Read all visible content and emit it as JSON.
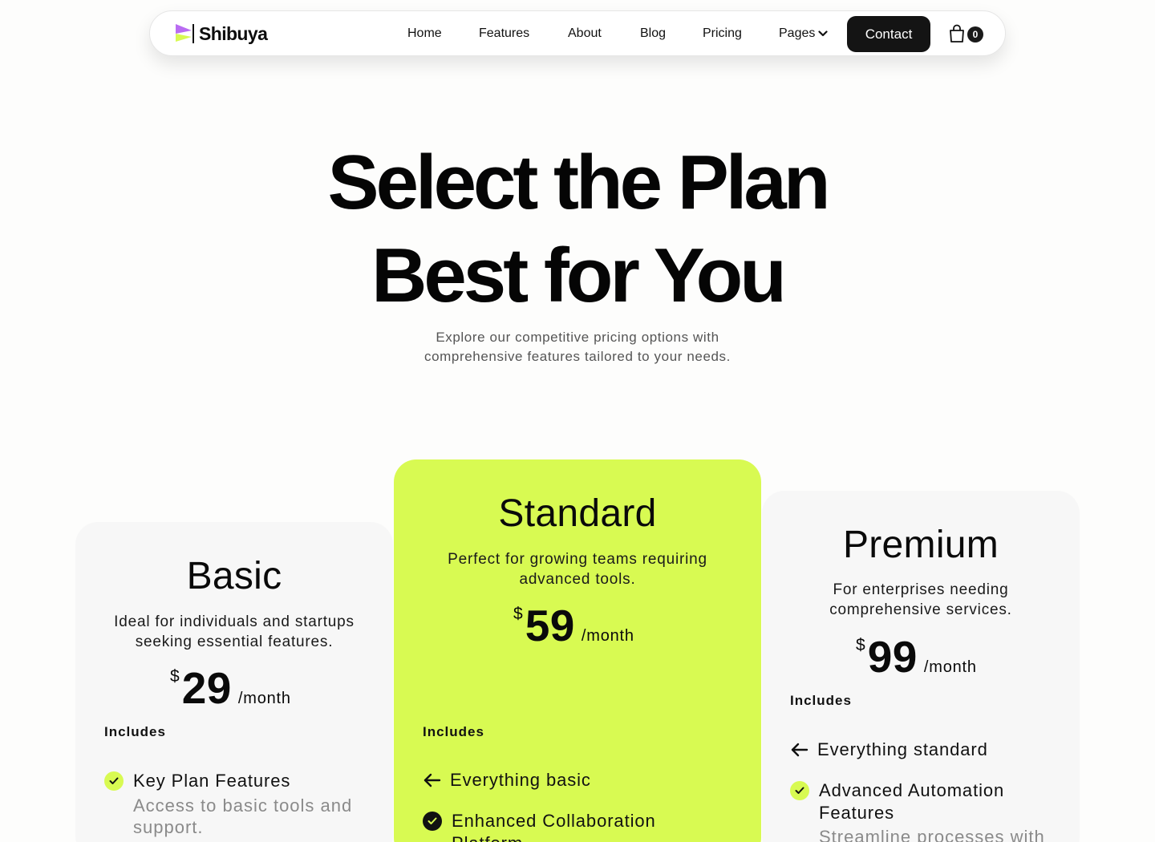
{
  "brand": {
    "name": "Shibuya",
    "logo_icon": "flag-logo-icon",
    "accent": "#d8fa52",
    "logo_purple": "#b96cf2"
  },
  "nav": {
    "links": [
      "Home",
      "Features",
      "About",
      "Blog",
      "Pricing"
    ],
    "pages_label": "Pages",
    "contact_label": "Contact",
    "cart_count": "0"
  },
  "hero": {
    "title_line1": "Select the Plan",
    "title_line2": "Best for You",
    "subtitle_line1": "Explore our competitive pricing options with",
    "subtitle_line2": "comprehensive features tailored to your needs."
  },
  "plans": [
    {
      "name": "Basic",
      "desc_line1": "Ideal for individuals and startups",
      "desc_line2": "seeking essential features.",
      "currency": "$",
      "price": "29",
      "period": "/month",
      "includes_label": "Includes",
      "features": [
        {
          "icon": "check-circle-icon",
          "title": "Key Plan Features",
          "desc_line1": "Access to basic tools and",
          "desc_line2": "support."
        }
      ]
    },
    {
      "name": "Standard",
      "desc_line1": "Perfect for growing teams requiring",
      "desc_line2": "advanced tools.",
      "currency": "$",
      "price": "59",
      "period": "/month",
      "includes_label": "Includes",
      "features": [
        {
          "icon": "arrow-left-icon",
          "title": "Everything basic"
        },
        {
          "icon": "check-circle-icon",
          "title_line1": "Enhanced Collaboration",
          "title_line2": "Platform"
        }
      ]
    },
    {
      "name": "Premium",
      "desc_line1": "For enterprises needing",
      "desc_line2": "comprehensive services.",
      "currency": "$",
      "price": "99",
      "period": "/month",
      "includes_label": "Includes",
      "features": [
        {
          "icon": "arrow-left-icon",
          "title": "Everything standard"
        },
        {
          "icon": "check-circle-icon",
          "title_line1": "Advanced Automation",
          "title_line2": "Features",
          "desc_line1": "Streamline processes with"
        }
      ]
    }
  ]
}
